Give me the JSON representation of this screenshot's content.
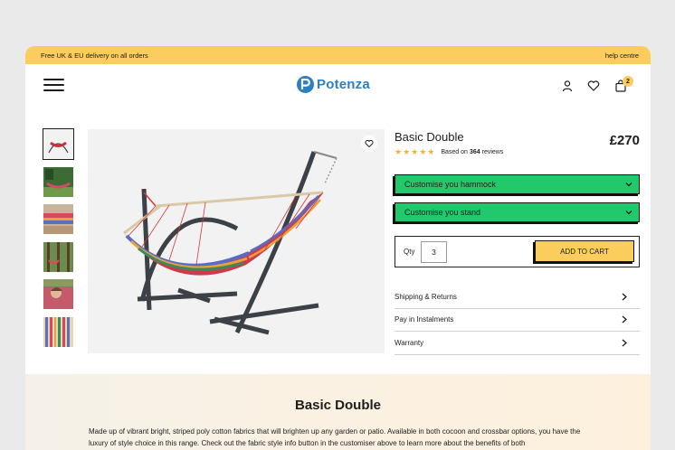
{
  "topbar": {
    "promo": "Free UK & EU delivery on all orders",
    "help": "help centre"
  },
  "header": {
    "logo": "Potenza",
    "cart_count": "2",
    "icons": [
      "menu-icon",
      "user-icon",
      "heart-icon",
      "bag-icon"
    ]
  },
  "product": {
    "title": "Basic Double",
    "price": "£270",
    "stars": "★★★★★",
    "rating_prefix": "Based on",
    "review_count": "364",
    "rating_suffix": "reviews",
    "customise_hammock": "Customise you hammock",
    "customise_stand": "Customise you stand",
    "qty_label": "Qty",
    "qty_value": "3",
    "add_to_cart": "ADD TO CART"
  },
  "accordion": [
    "Shipping & Returns",
    "Pay in Instalments",
    "Warranty"
  ],
  "description": {
    "heading": "Basic Double",
    "text": "Made up of vibrant bright, striped poly cotton fabrics that will brighten up any garden or patio. Available in both cocoon and crossbar options, you have the luxury of style choice in this range. Check out the fabric style info button in the customiser above to learn more about the benefits of both"
  },
  "colors": {
    "accent_yellow": "#fbcd5c",
    "customise_green": "#22c96c",
    "brand_blue": "#2b7fc2"
  }
}
